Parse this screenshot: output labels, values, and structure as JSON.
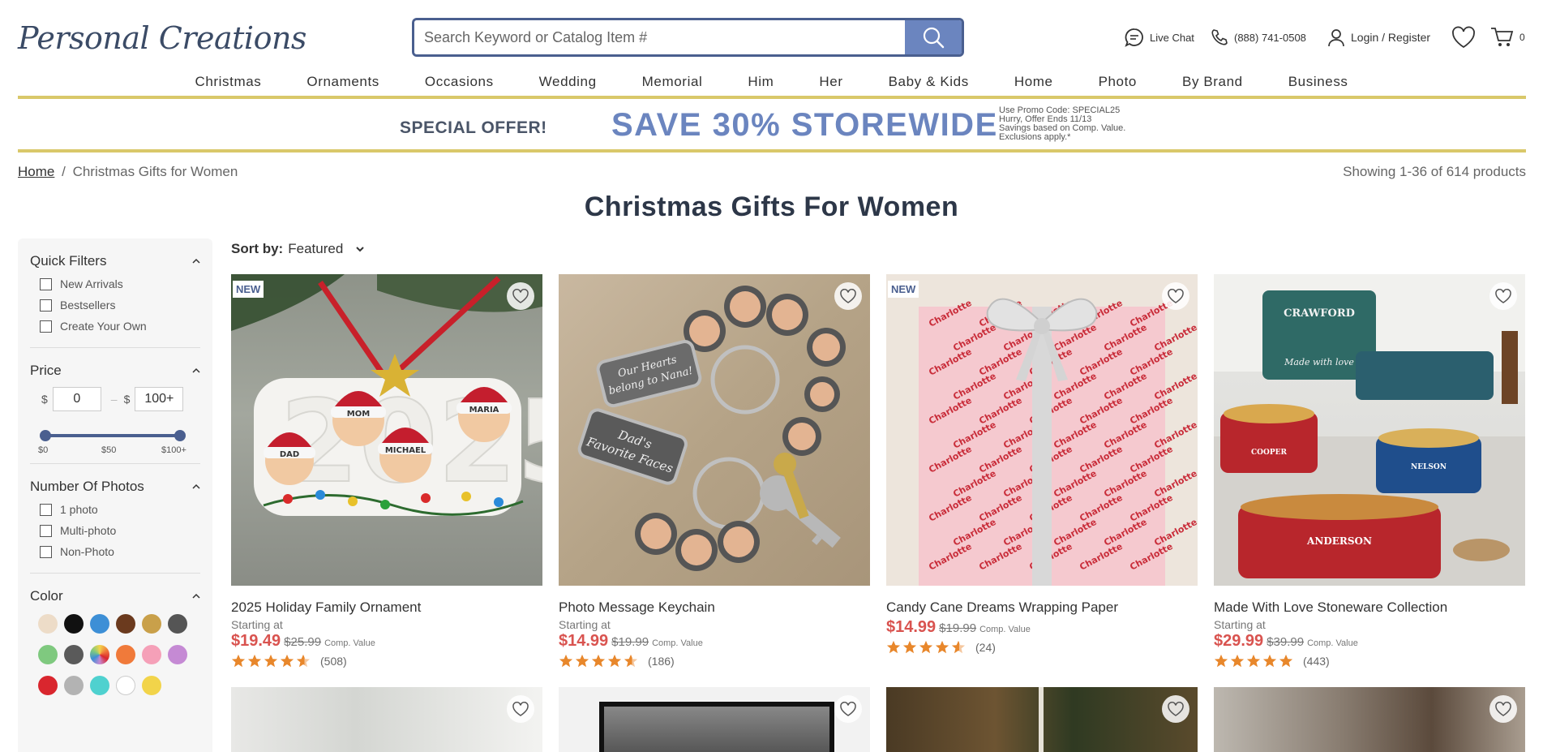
{
  "header": {
    "logo_text": "Personal Creations",
    "search_placeholder": "Search Keyword or Catalog Item #",
    "live_chat": "Live Chat",
    "phone": "(888) 741-0508",
    "login": "Login / Register",
    "cart_count": "0"
  },
  "nav": [
    "Christmas",
    "Ornaments",
    "Occasions",
    "Wedding",
    "Memorial",
    "Him",
    "Her",
    "Baby & Kids",
    "Home",
    "Photo",
    "By Brand",
    "Business"
  ],
  "promo": {
    "offer": "SPECIAL OFFER!",
    "main": "SAVE 30% STOREWIDE",
    "fine": [
      "Use Promo Code: SPECIAL25",
      "Hurry, Offer Ends 11/13",
      "Savings based on Comp. Value.",
      "Exclusions apply.*"
    ]
  },
  "breadcrumb": {
    "home": "Home",
    "separator": "/",
    "current": "Christmas Gifts for Women"
  },
  "showing": "Showing 1-36 of 614 products",
  "page_title": "Christmas Gifts For Women",
  "sort": {
    "label": "Sort by:",
    "value": "Featured"
  },
  "filters": {
    "quick": {
      "title": "Quick Filters",
      "options": [
        "New Arrivals",
        "Bestsellers",
        "Create Your Own"
      ]
    },
    "price": {
      "title": "Price",
      "currency": "$",
      "min": "0",
      "max": "100+",
      "labels": [
        "$0",
        "$50",
        "$100+"
      ]
    },
    "photos": {
      "title": "Number Of Photos",
      "options": [
        "1 photo",
        "Multi-photo",
        "Non-Photo"
      ]
    },
    "color": {
      "title": "Color",
      "swatches": [
        "#eddcc8",
        "#111111",
        "#3d8fd6",
        "#6b3a1e",
        "#c9a04a",
        "#555555",
        "#7fc97f",
        "#5a5a5a",
        "rainbow",
        "#f07a3a",
        "#f5a0b8",
        "#c58ad4",
        "#d9262e",
        "#b3b3b3",
        "#4fd1cf",
        "#ffffff",
        "#f2d44a"
      ]
    }
  },
  "products": [
    {
      "name": "2025 Holiday Family Ornament",
      "starting": "Starting at",
      "price": "$19.49",
      "was": "$25.99",
      "comp": "Comp. Value",
      "reviews": "(508)",
      "new": "NEW"
    },
    {
      "name": "Photo Message Keychain",
      "starting": "Starting at",
      "price": "$14.99",
      "was": "$19.99",
      "comp": "Comp. Value",
      "reviews": "(186)",
      "new": ""
    },
    {
      "name": "Candy Cane Dreams Wrapping Paper",
      "starting": "",
      "price": "$14.99",
      "was": "$19.99",
      "comp": "Comp. Value",
      "reviews": "(24)",
      "new": "NEW"
    },
    {
      "name": "Made With Love Stoneware Collection",
      "starting": "Starting at",
      "price": "$29.99",
      "was": "$39.99",
      "comp": "Comp. Value",
      "reviews": "(443)",
      "new": ""
    }
  ],
  "product_image_text": {
    "ornament_year": "2025",
    "ornament_names": [
      "DAD",
      "MOM",
      "MICHAEL",
      "MARIA"
    ],
    "keychain_tags": [
      "Our Hearts belong to Nana!",
      "Dad's Favorite Faces"
    ],
    "wrap_name": "Charlotte",
    "stoneware": [
      "CRAWFORD",
      "Made with love",
      "COOPER",
      "NELSON",
      "ANDERSON"
    ]
  },
  "colors": {
    "accent": "#6b85bf",
    "price": "#d9534f",
    "promo_border": "#d9c86a",
    "star": "#e8872b"
  }
}
